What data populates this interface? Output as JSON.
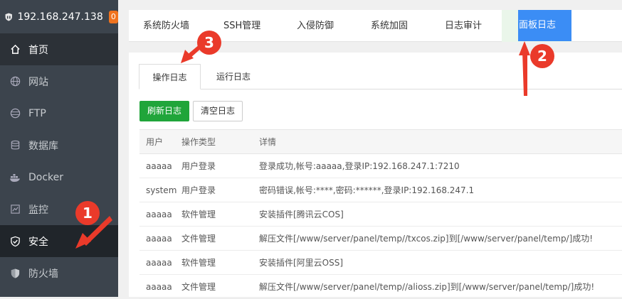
{
  "sidebar": {
    "ip": "192.168.247.138",
    "badge": "0",
    "items": [
      {
        "label": "首页",
        "icon": "home-icon"
      },
      {
        "label": "网站",
        "icon": "globe-icon"
      },
      {
        "label": "FTP",
        "icon": "ftp-icon"
      },
      {
        "label": "数据库",
        "icon": "database-icon"
      },
      {
        "label": "Docker",
        "icon": "docker-icon"
      },
      {
        "label": "监控",
        "icon": "monitor-icon"
      },
      {
        "label": "安全",
        "icon": "shield-check-icon"
      },
      {
        "label": "防火墙",
        "icon": "shield-icon"
      }
    ]
  },
  "top_tabs": [
    "系统防火墙",
    "SSH管理",
    "入侵防御",
    "系统加固",
    "日志审计",
    "面板日志"
  ],
  "sub_tabs": [
    "操作日志",
    "运行日志"
  ],
  "buttons": {
    "refresh": "刷新日志",
    "clear": "清空日志"
  },
  "table": {
    "headers": [
      "用户",
      "操作类型",
      "详情"
    ],
    "rows": [
      [
        "aaaaa",
        "用户登录",
        "登录成功,帐号:aaaaa,登录IP:192.168.247.1:7210"
      ],
      [
        "system",
        "用户登录",
        "密码错误,帐号:****,密码:******,登录IP:192.168.247.1"
      ],
      [
        "aaaaa",
        "软件管理",
        "安装插件[腾讯云COS]"
      ],
      [
        "aaaaa",
        "文件管理",
        "解压文件[/www/server/panel/temp//txcos.zip]到[/www/server/panel/temp/]成功!"
      ],
      [
        "aaaaa",
        "软件管理",
        "安装插件[阿里云OSS]"
      ],
      [
        "aaaaa",
        "文件管理",
        "解压文件[/www/server/panel/temp//alioss.zip]到[/www/server/panel/temp/]成功!"
      ]
    ]
  },
  "annotations": [
    "1",
    "2",
    "3"
  ],
  "colors": {
    "accent_green": "#20a53a",
    "accent_blue": "#3b8df5",
    "marker_red": "#ea3a2a",
    "sidebar_bg": "#3c444d"
  }
}
